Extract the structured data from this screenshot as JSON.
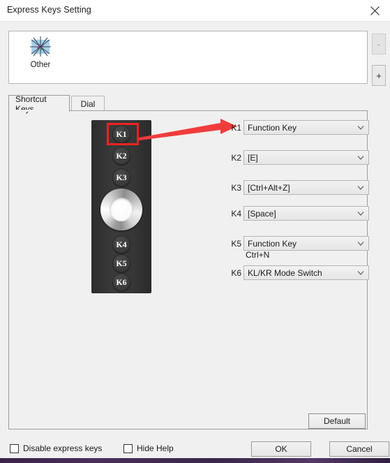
{
  "window": {
    "title": "Express Keys Setting",
    "close_icon": "close-icon"
  },
  "profile_panel": {
    "items": [
      {
        "label": "Other",
        "icon": "starburst-app-icon"
      }
    ],
    "remove_label": "-",
    "add_label": "+"
  },
  "tabs": [
    {
      "label": "Shortcut Keys",
      "active": true
    },
    {
      "label": "Dial",
      "active": false
    }
  ],
  "tablet": {
    "buttons": [
      "K1",
      "K2",
      "K3",
      "K4",
      "K5",
      "K6"
    ],
    "dial_name": "dial-wheel",
    "highlight_key": "K1",
    "highlight_color": "#ee2222",
    "arrow_color": "#f13c3c"
  },
  "key_rows": [
    {
      "key": "K1",
      "value": "Function Key",
      "sub": ""
    },
    {
      "key": "K2",
      "value": "[E]",
      "sub": ""
    },
    {
      "key": "K3",
      "value": "[Ctrl+Alt+Z]",
      "sub": ""
    },
    {
      "key": "K4",
      "value": "[Space]",
      "sub": ""
    },
    {
      "key": "K5",
      "value": "Function Key",
      "sub": "Ctrl+N"
    },
    {
      "key": "K6",
      "value": "KL/KR Mode Switch",
      "sub": ""
    }
  ],
  "footer": {
    "default_label": "Default",
    "disable_express_keys_label": "Disable express keys",
    "disable_express_keys_checked": false,
    "hide_help_label": "Hide Help",
    "hide_help_checked": false,
    "ok_label": "OK",
    "cancel_label": "Cancel"
  }
}
